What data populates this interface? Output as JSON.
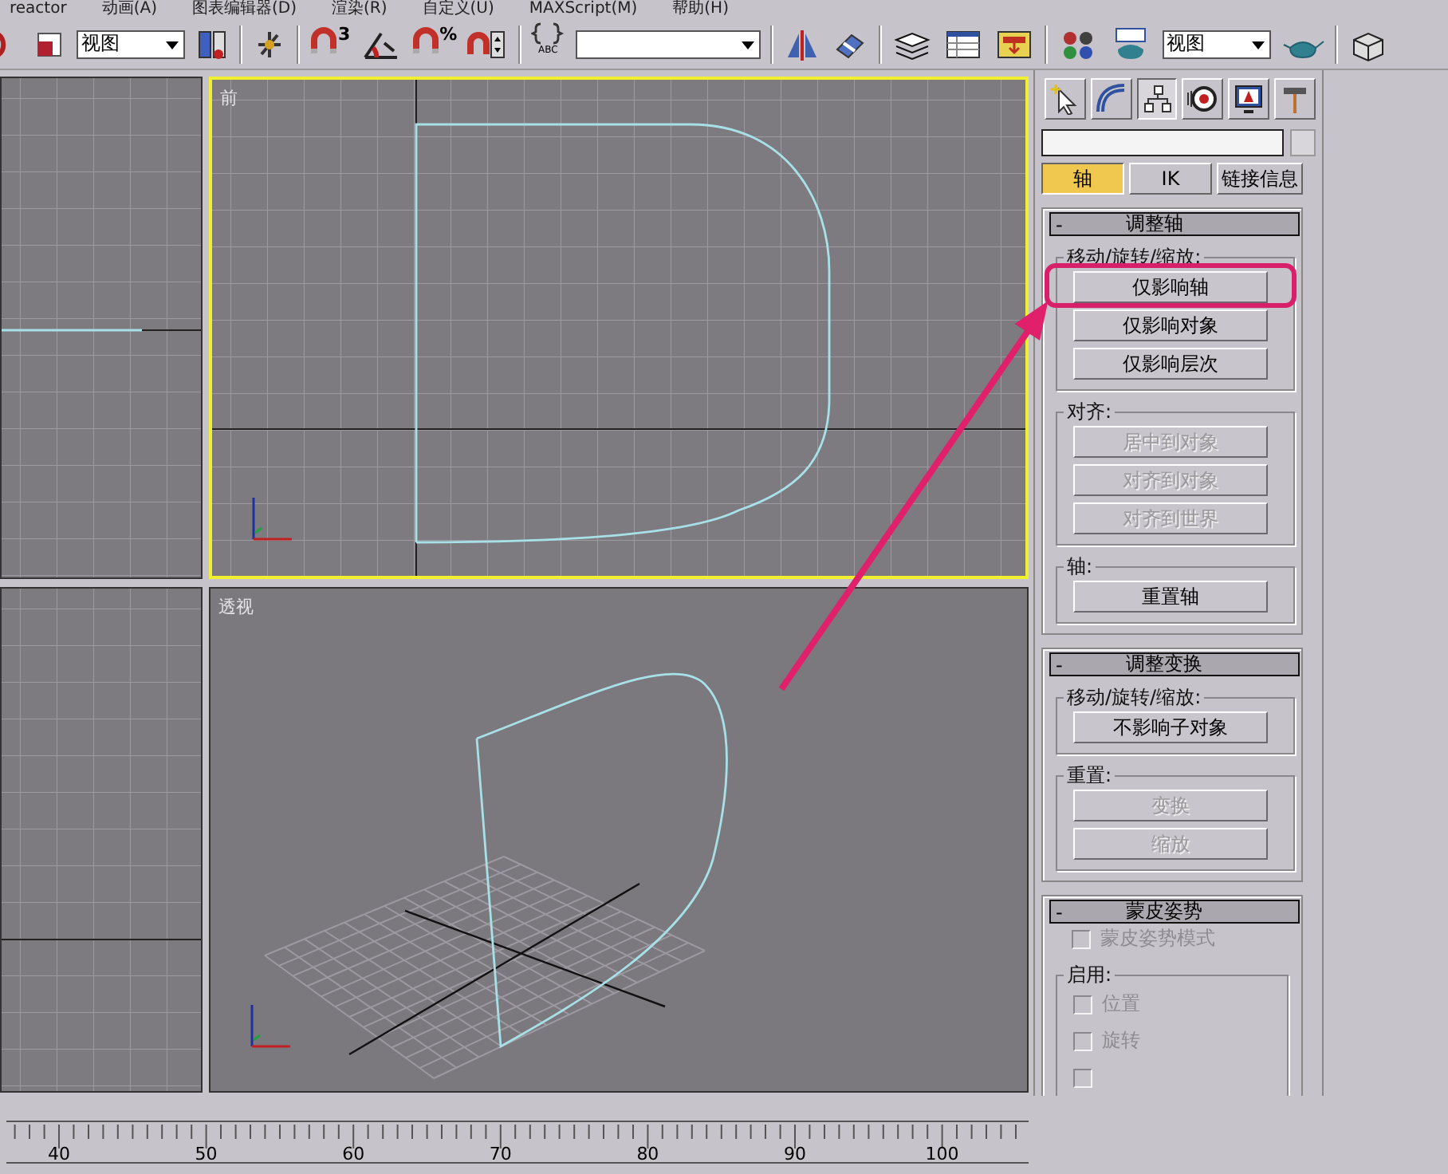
{
  "menu_bar": [
    "reactor",
    "动画(A)",
    "图表编辑器(D)",
    "渲染(R)",
    "自定义(U)",
    "MAXScript(M)",
    "帮助(H)"
  ],
  "toolbar": [
    {
      "kind": "undo"
    },
    {
      "kind": "swatch"
    },
    {
      "kind": "dropdown",
      "value": "视图"
    },
    {
      "kind": "window-crossing"
    },
    {
      "kind": "separator"
    },
    {
      "kind": "pivot"
    },
    {
      "kind": "separator"
    },
    {
      "kind": "snap",
      "glyph": "3"
    },
    {
      "kind": "angle-snap"
    },
    {
      "kind": "snap",
      "glyph": "%"
    },
    {
      "kind": "spinner-snap"
    },
    {
      "kind": "separator"
    },
    {
      "kind": "named-set",
      "glyph": "ABC"
    },
    {
      "kind": "dropdown"
    },
    {
      "kind": "separator"
    },
    {
      "kind": "mirror"
    },
    {
      "kind": "align"
    },
    {
      "kind": "separator"
    },
    {
      "kind": "layers"
    },
    {
      "kind": "curve-editor"
    },
    {
      "kind": "schematic"
    },
    {
      "kind": "separator"
    },
    {
      "kind": "material"
    },
    {
      "kind": "render-setup"
    },
    {
      "kind": "dropdown",
      "value": "视图"
    },
    {
      "kind": "teapot"
    },
    {
      "kind": "separator"
    },
    {
      "kind": "box"
    }
  ],
  "viewports": [
    {
      "kind": "shape-edge",
      "active": false
    },
    {
      "kind": "front",
      "label": "前",
      "active": true
    },
    {
      "kind": "empty-grid",
      "active": false
    },
    {
      "kind": "perspective",
      "label": "透视",
      "active": false
    }
  ],
  "command_panel": {
    "tabs": [
      {
        "kind": "create",
        "selected": false
      },
      {
        "kind": "modify",
        "selected": false
      },
      {
        "kind": "hierarchy",
        "selected": true
      },
      {
        "kind": "motion",
        "selected": false
      },
      {
        "kind": "display",
        "selected": false
      },
      {
        "kind": "utilities",
        "selected": false
      }
    ],
    "subtabs": [
      {
        "label": "轴",
        "selected": true
      },
      {
        "label": "IK",
        "selected": false
      },
      {
        "label": "链接信息",
        "selected": false
      }
    ],
    "rollouts": [
      {
        "title": "调整轴",
        "collapse": "-",
        "content": [
          {
            "kind": "group",
            "title": "移动/旋转/缩放:",
            "items": [
              {
                "kind": "button",
                "label": "仅影响轴",
                "disabled": false,
                "callout": true
              },
              {
                "kind": "button",
                "label": "仅影响对象",
                "disabled": false
              },
              {
                "kind": "button",
                "label": "仅影响层次",
                "disabled": false
              }
            ]
          },
          {
            "kind": "group",
            "title": "对齐:",
            "items": [
              {
                "kind": "button",
                "label": "居中到对象",
                "disabled": true
              },
              {
                "kind": "button",
                "label": "对齐到对象",
                "disabled": true
              },
              {
                "kind": "button",
                "label": "对齐到世界",
                "disabled": true
              }
            ]
          },
          {
            "kind": "group",
            "title": "轴:",
            "items": [
              {
                "kind": "button",
                "label": "重置轴",
                "disabled": false
              }
            ]
          }
        ]
      },
      {
        "title": "调整变换",
        "collapse": "-",
        "content": [
          {
            "kind": "group",
            "title": "移动/旋转/缩放:",
            "items": [
              {
                "kind": "button",
                "label": "不影响子对象",
                "disabled": false
              }
            ]
          },
          {
            "kind": "group",
            "title": "重置:",
            "items": [
              {
                "kind": "button",
                "label": "变换",
                "disabled": true
              },
              {
                "kind": "button",
                "label": "缩放",
                "disabled": true
              }
            ]
          }
        ]
      },
      {
        "title": "蒙皮姿势",
        "collapse": "-",
        "content": [
          {
            "kind": "checkbox",
            "label": "蒙皮姿势模式",
            "checked": false,
            "disabled": true
          },
          {
            "kind": "group",
            "title": "启用:",
            "items": [
              {
                "kind": "checkbox",
                "label": "位置",
                "checked": false,
                "disabled": true
              },
              {
                "kind": "checkbox",
                "label": "旋转",
                "checked": false,
                "disabled": true
              },
              {
                "kind": "checkbox",
                "checked": false,
                "disabled": true
              }
            ]
          }
        ]
      }
    ]
  },
  "annotation": {
    "kind": "arrow"
  },
  "timeline": {
    "tick_labels": [
      "40",
      "50",
      "60",
      "70",
      "80",
      "90",
      "100"
    ]
  }
}
